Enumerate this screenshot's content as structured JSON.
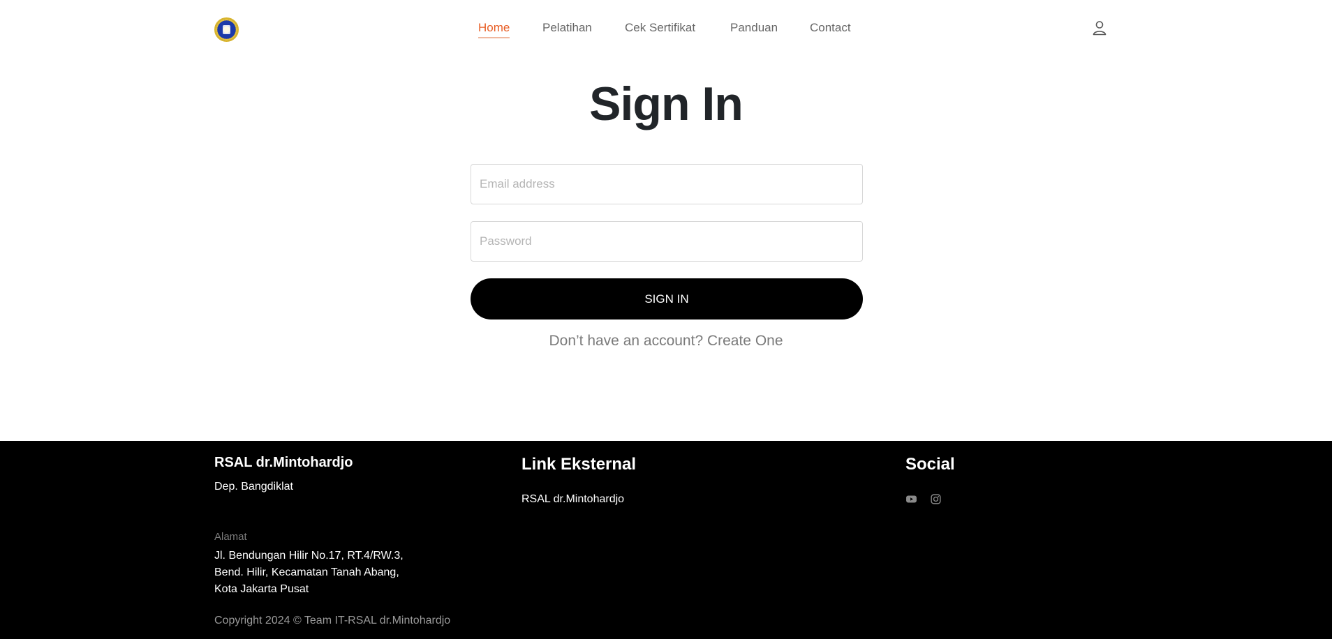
{
  "nav": {
    "items": [
      {
        "label": "Home",
        "active": true
      },
      {
        "label": "Pelatihan",
        "active": false
      },
      {
        "label": "Cek Sertifikat",
        "active": false
      },
      {
        "label": "Panduan",
        "active": false
      },
      {
        "label": "Contact",
        "active": false
      }
    ],
    "active_color": "#e85d24",
    "user_icon": "person-icon",
    "logo_icon": "hospital-emblem-icon"
  },
  "signin": {
    "title": "Sign In",
    "email_placeholder": "Email address",
    "email_value": "",
    "password_placeholder": "Password",
    "password_value": "",
    "button_label": "SIGN IN",
    "create_account_text": "Don’t have an account? Create One"
  },
  "footer": {
    "brand": "RSAL dr.Mintohardjo",
    "department": "Dep. Bangdiklat",
    "address_label": "Alamat",
    "address_lines": [
      "Jl. Bendungan Hilir No.17, RT.4/RW.3,",
      "Bend. Hilir, Kecamatan Tanah Abang,",
      "Kota Jakarta Pusat"
    ],
    "copyright": "Copyright 2024 © Team IT-RSAL dr.Mintohardjo",
    "links_title": "Link Eksternal",
    "links": [
      {
        "label": "RSAL dr.Mintohardjo"
      }
    ],
    "social_title": "Social",
    "social_icons": [
      "youtube-icon",
      "instagram-icon"
    ]
  }
}
